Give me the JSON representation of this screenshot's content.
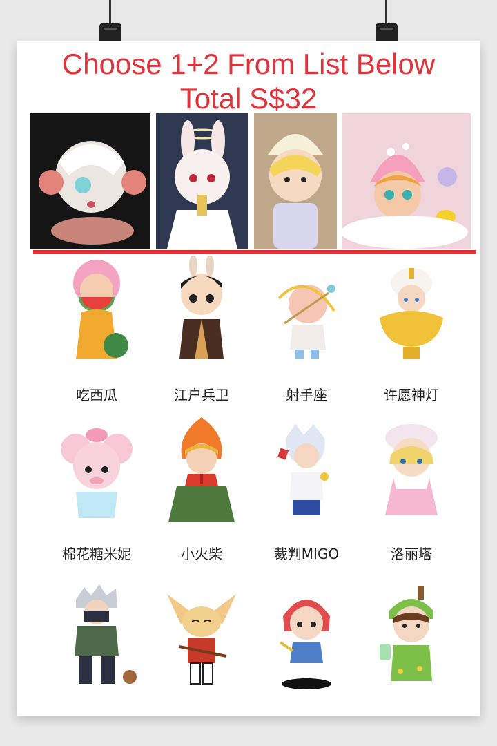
{
  "headline": {
    "line1": "Choose 1+2 From List Below",
    "line2": "Total S$32"
  },
  "colors": {
    "accent": "#e0343d",
    "poster_bg": "#ffffff",
    "wall": "#e9e9ea"
  },
  "figures": [
    {
      "name": "吃西瓜"
    },
    {
      "name": "江户兵卫"
    },
    {
      "name": "射手座"
    },
    {
      "name": "许愿神灯"
    },
    {
      "name": "棉花糖米妮"
    },
    {
      "name": "小火柴"
    },
    {
      "name": "裁判MIGO"
    },
    {
      "name": "洛丽塔"
    },
    {
      "name": ""
    },
    {
      "name": ""
    },
    {
      "name": ""
    },
    {
      "name": ""
    }
  ]
}
